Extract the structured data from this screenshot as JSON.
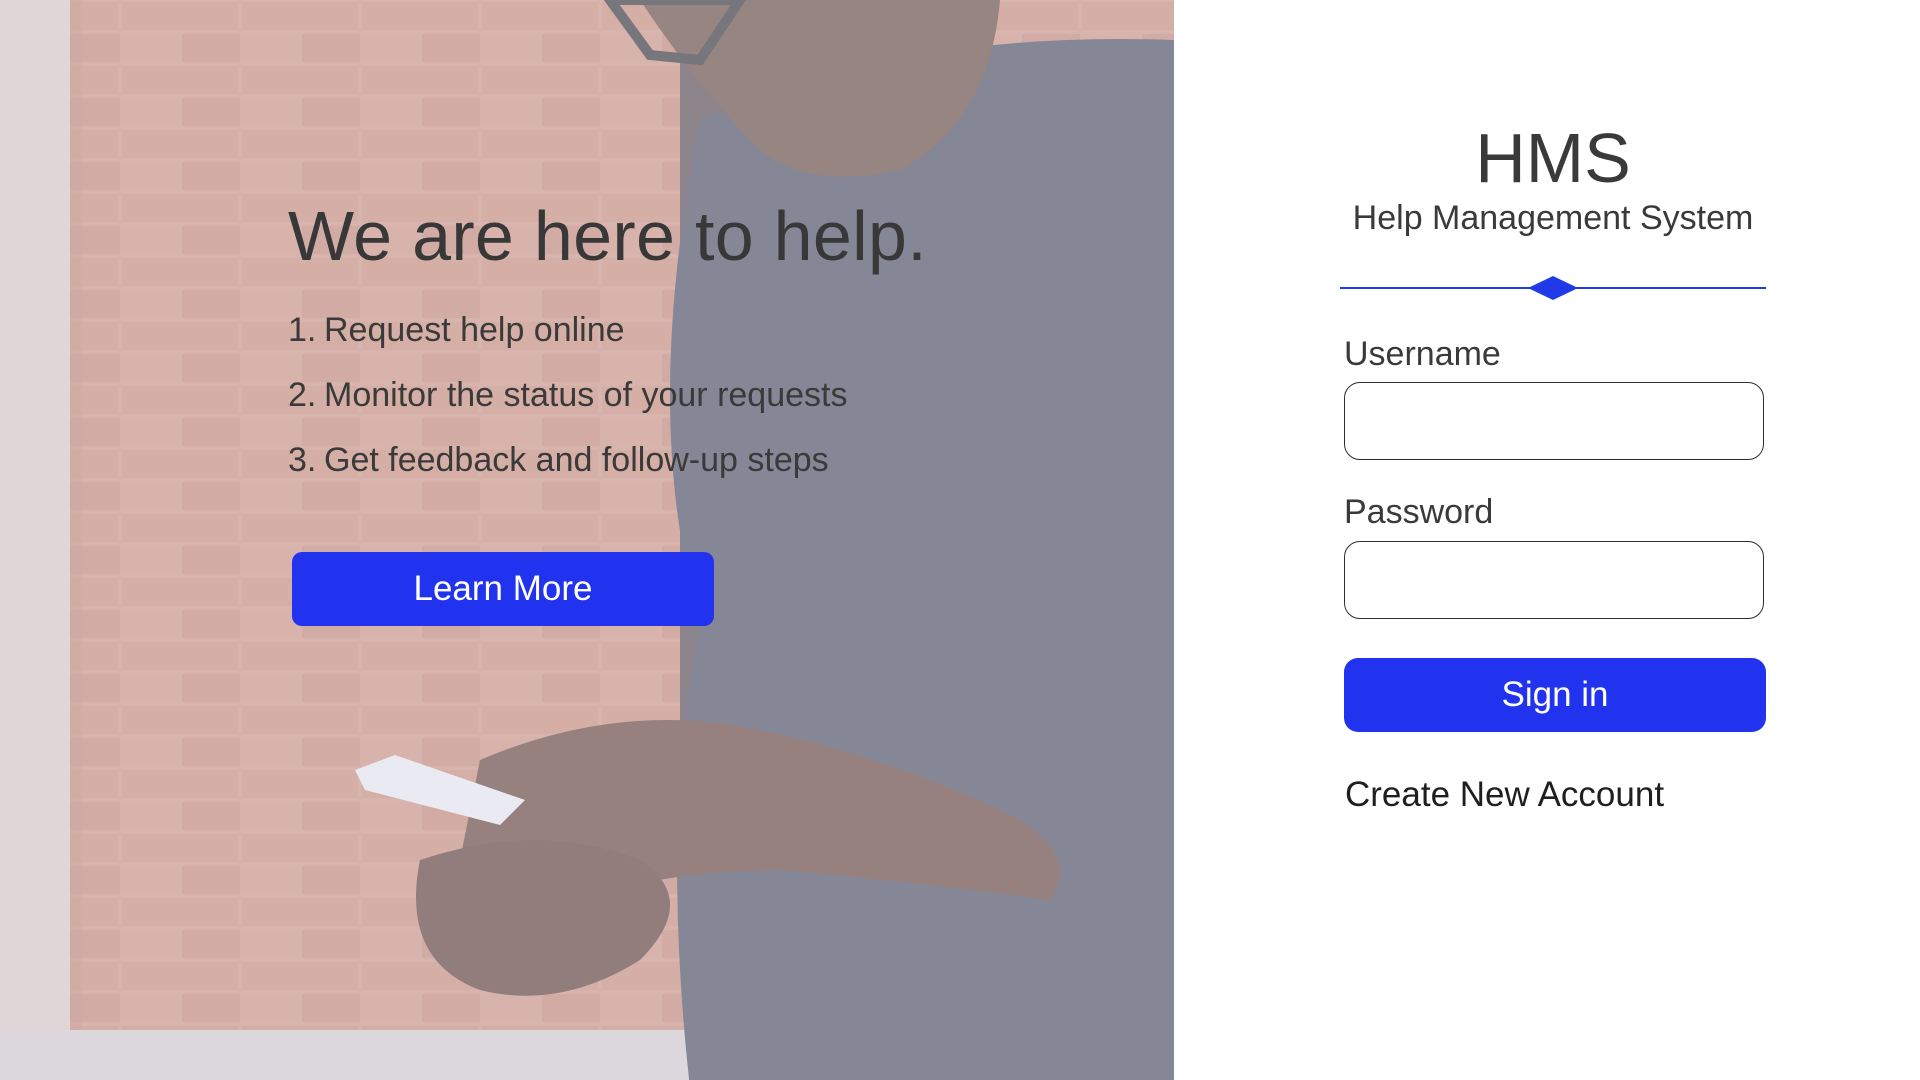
{
  "hero": {
    "title": "We are here to help.",
    "steps": [
      {
        "number": "1.",
        "text": "Request help online"
      },
      {
        "number": "2.",
        "text": "Monitor the status of your requests"
      },
      {
        "number": "3.",
        "text": "Get feedback and follow-up steps"
      }
    ],
    "learn_more_label": "Learn More",
    "background_image": "person-holding-smartphone-by-brick-wall"
  },
  "login": {
    "title": "HMS",
    "subtitle": "Help Management System",
    "username_label": "Username",
    "username_value": "",
    "password_label": "Password",
    "password_value": "",
    "sign_in_label": "Sign in",
    "create_account_label": "Create New Account"
  },
  "colors": {
    "accent": "#2233f0",
    "text": "#3a3a3a",
    "divider": "#1f3ae8"
  }
}
